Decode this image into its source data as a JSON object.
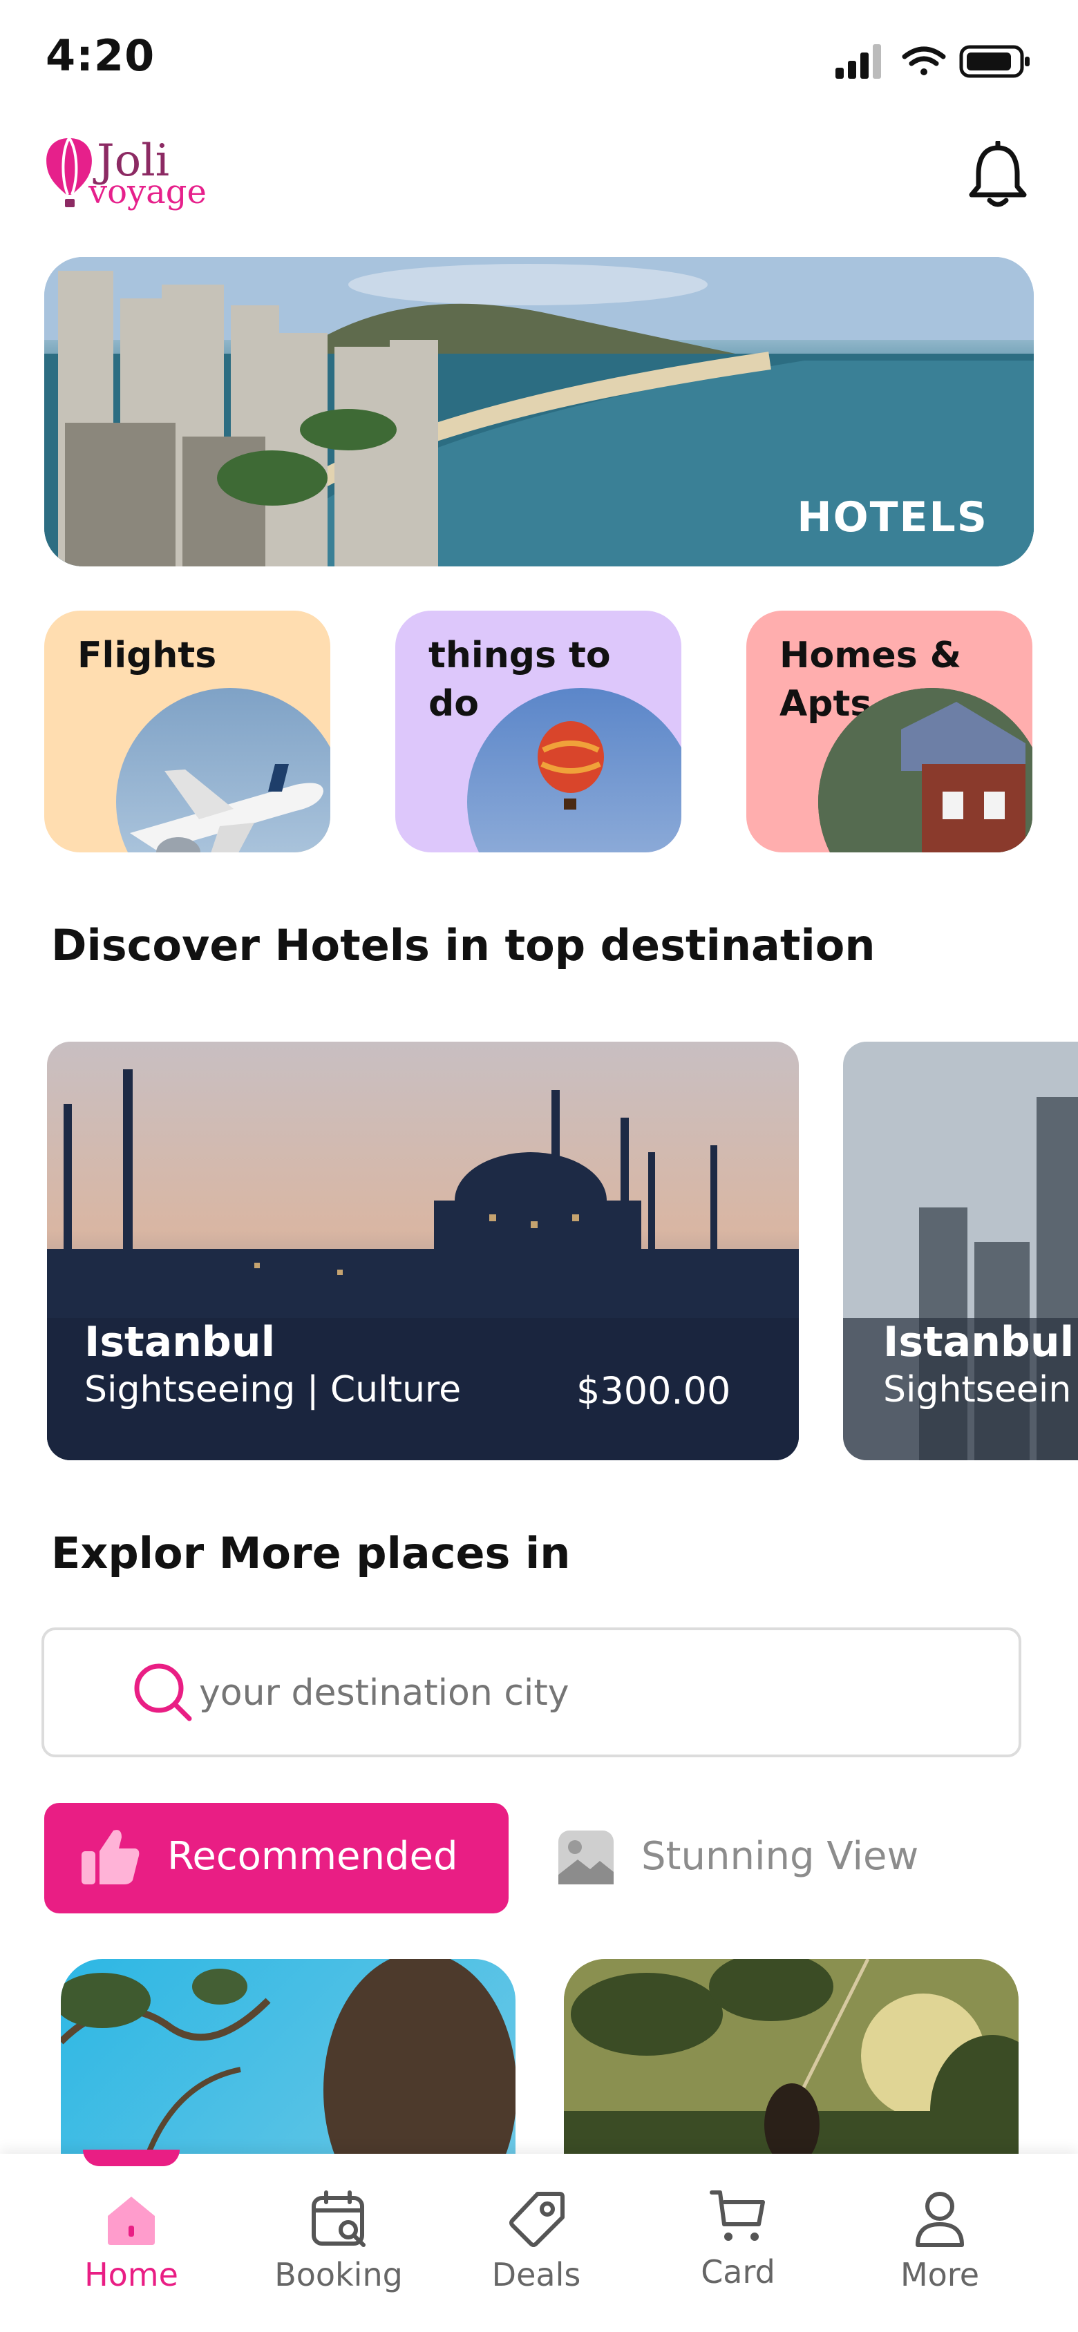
{
  "status_bar": {
    "time": "4:20"
  },
  "header": {
    "logo_line1": "Joli",
    "logo_line2": "voyage"
  },
  "hero": {
    "label": "HOTELS"
  },
  "categories": [
    {
      "label": "Flights",
      "color": "#FFDDB0"
    },
    {
      "label": "things to do",
      "color": "#DDC7FB"
    },
    {
      "label": "Homes & Apts",
      "color": "#FFAEAE"
    }
  ],
  "discover": {
    "title": "Discover Hotels in top destination",
    "cards": [
      {
        "name": "Istanbul",
        "subtitle": "Sightseeing | Culture",
        "price": "$300.00"
      },
      {
        "name": "Istanbul",
        "subtitle": "Sightseein"
      }
    ]
  },
  "explore": {
    "title": "Explor More places in",
    "search_placeholder": "your destination city"
  },
  "tabs": [
    {
      "label": "Recommended",
      "active": true
    },
    {
      "label": "Stunning View",
      "active": false
    }
  ],
  "bottom_nav": [
    {
      "label": "Home",
      "icon": "home-icon",
      "active": true
    },
    {
      "label": "Booking",
      "icon": "calendar-search-icon"
    },
    {
      "label": "Deals",
      "icon": "tag-icon"
    },
    {
      "label": "Card",
      "icon": "cart-icon"
    },
    {
      "label": "More",
      "icon": "user-icon"
    }
  ],
  "colors": {
    "accent": "#E91E84",
    "muted_text": "#8C8C8C"
  }
}
